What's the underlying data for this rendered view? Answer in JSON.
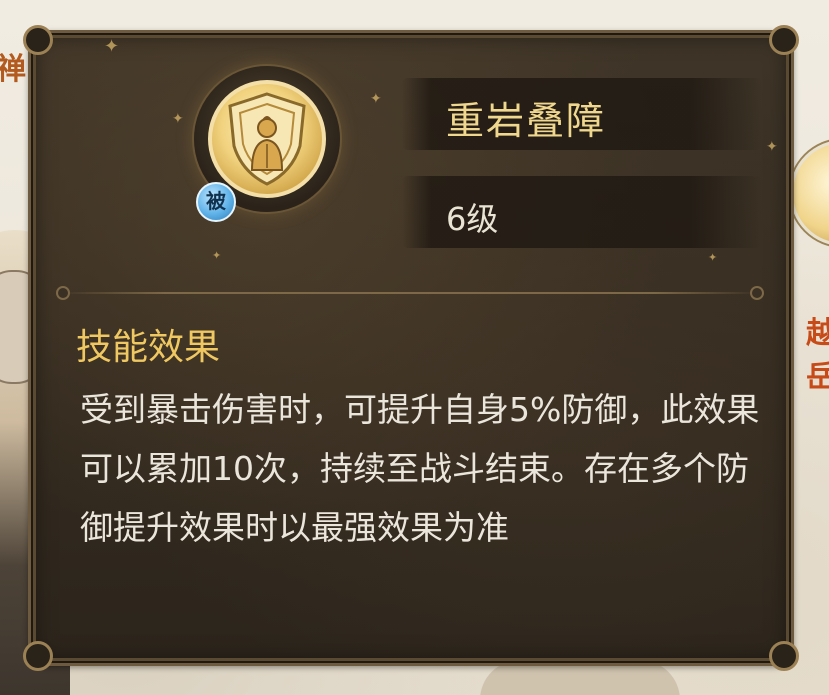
{
  "background": {
    "left_text": "禅",
    "right_text": "越岳"
  },
  "skill": {
    "name": "重岩叠障",
    "level": "6级",
    "badge": "被",
    "icon": "shield-figure-icon",
    "section_title": "技能效果",
    "description": "受到暴击伤害时，可提升自身5%防御，此效果可以累加10次，持续至战斗结束。存在多个防御提升效果时以最强效果为准"
  },
  "colors": {
    "panel_bg": "#342b20",
    "title_gold": "#f0d78e",
    "section_gold": "#f0c862",
    "text_light": "#ebe6dc",
    "badge_blue": "#5fb2e8"
  }
}
